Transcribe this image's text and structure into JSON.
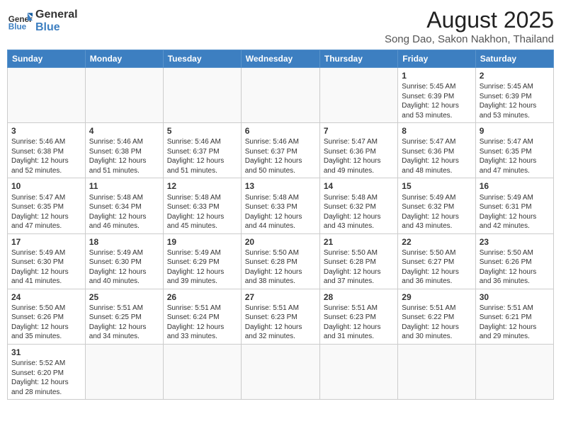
{
  "logo": {
    "text_general": "General",
    "text_blue": "Blue"
  },
  "title": "August 2025",
  "subtitle": "Song Dao, Sakon Nakhon, Thailand",
  "days_of_week": [
    "Sunday",
    "Monday",
    "Tuesday",
    "Wednesday",
    "Thursday",
    "Friday",
    "Saturday"
  ],
  "weeks": [
    [
      {
        "day": "",
        "info": ""
      },
      {
        "day": "",
        "info": ""
      },
      {
        "day": "",
        "info": ""
      },
      {
        "day": "",
        "info": ""
      },
      {
        "day": "",
        "info": ""
      },
      {
        "day": "1",
        "info": "Sunrise: 5:45 AM\nSunset: 6:39 PM\nDaylight: 12 hours\nand 53 minutes."
      },
      {
        "day": "2",
        "info": "Sunrise: 5:45 AM\nSunset: 6:39 PM\nDaylight: 12 hours\nand 53 minutes."
      }
    ],
    [
      {
        "day": "3",
        "info": "Sunrise: 5:46 AM\nSunset: 6:38 PM\nDaylight: 12 hours\nand 52 minutes."
      },
      {
        "day": "4",
        "info": "Sunrise: 5:46 AM\nSunset: 6:38 PM\nDaylight: 12 hours\nand 51 minutes."
      },
      {
        "day": "5",
        "info": "Sunrise: 5:46 AM\nSunset: 6:37 PM\nDaylight: 12 hours\nand 51 minutes."
      },
      {
        "day": "6",
        "info": "Sunrise: 5:46 AM\nSunset: 6:37 PM\nDaylight: 12 hours\nand 50 minutes."
      },
      {
        "day": "7",
        "info": "Sunrise: 5:47 AM\nSunset: 6:36 PM\nDaylight: 12 hours\nand 49 minutes."
      },
      {
        "day": "8",
        "info": "Sunrise: 5:47 AM\nSunset: 6:36 PM\nDaylight: 12 hours\nand 48 minutes."
      },
      {
        "day": "9",
        "info": "Sunrise: 5:47 AM\nSunset: 6:35 PM\nDaylight: 12 hours\nand 47 minutes."
      }
    ],
    [
      {
        "day": "10",
        "info": "Sunrise: 5:47 AM\nSunset: 6:35 PM\nDaylight: 12 hours\nand 47 minutes."
      },
      {
        "day": "11",
        "info": "Sunrise: 5:48 AM\nSunset: 6:34 PM\nDaylight: 12 hours\nand 46 minutes."
      },
      {
        "day": "12",
        "info": "Sunrise: 5:48 AM\nSunset: 6:33 PM\nDaylight: 12 hours\nand 45 minutes."
      },
      {
        "day": "13",
        "info": "Sunrise: 5:48 AM\nSunset: 6:33 PM\nDaylight: 12 hours\nand 44 minutes."
      },
      {
        "day": "14",
        "info": "Sunrise: 5:48 AM\nSunset: 6:32 PM\nDaylight: 12 hours\nand 43 minutes."
      },
      {
        "day": "15",
        "info": "Sunrise: 5:49 AM\nSunset: 6:32 PM\nDaylight: 12 hours\nand 43 minutes."
      },
      {
        "day": "16",
        "info": "Sunrise: 5:49 AM\nSunset: 6:31 PM\nDaylight: 12 hours\nand 42 minutes."
      }
    ],
    [
      {
        "day": "17",
        "info": "Sunrise: 5:49 AM\nSunset: 6:30 PM\nDaylight: 12 hours\nand 41 minutes."
      },
      {
        "day": "18",
        "info": "Sunrise: 5:49 AM\nSunset: 6:30 PM\nDaylight: 12 hours\nand 40 minutes."
      },
      {
        "day": "19",
        "info": "Sunrise: 5:49 AM\nSunset: 6:29 PM\nDaylight: 12 hours\nand 39 minutes."
      },
      {
        "day": "20",
        "info": "Sunrise: 5:50 AM\nSunset: 6:28 PM\nDaylight: 12 hours\nand 38 minutes."
      },
      {
        "day": "21",
        "info": "Sunrise: 5:50 AM\nSunset: 6:28 PM\nDaylight: 12 hours\nand 37 minutes."
      },
      {
        "day": "22",
        "info": "Sunrise: 5:50 AM\nSunset: 6:27 PM\nDaylight: 12 hours\nand 36 minutes."
      },
      {
        "day": "23",
        "info": "Sunrise: 5:50 AM\nSunset: 6:26 PM\nDaylight: 12 hours\nand 36 minutes."
      }
    ],
    [
      {
        "day": "24",
        "info": "Sunrise: 5:50 AM\nSunset: 6:26 PM\nDaylight: 12 hours\nand 35 minutes."
      },
      {
        "day": "25",
        "info": "Sunrise: 5:51 AM\nSunset: 6:25 PM\nDaylight: 12 hours\nand 34 minutes."
      },
      {
        "day": "26",
        "info": "Sunrise: 5:51 AM\nSunset: 6:24 PM\nDaylight: 12 hours\nand 33 minutes."
      },
      {
        "day": "27",
        "info": "Sunrise: 5:51 AM\nSunset: 6:23 PM\nDaylight: 12 hours\nand 32 minutes."
      },
      {
        "day": "28",
        "info": "Sunrise: 5:51 AM\nSunset: 6:23 PM\nDaylight: 12 hours\nand 31 minutes."
      },
      {
        "day": "29",
        "info": "Sunrise: 5:51 AM\nSunset: 6:22 PM\nDaylight: 12 hours\nand 30 minutes."
      },
      {
        "day": "30",
        "info": "Sunrise: 5:51 AM\nSunset: 6:21 PM\nDaylight: 12 hours\nand 29 minutes."
      }
    ],
    [
      {
        "day": "31",
        "info": "Sunrise: 5:52 AM\nSunset: 6:20 PM\nDaylight: 12 hours\nand 28 minutes."
      },
      {
        "day": "",
        "info": ""
      },
      {
        "day": "",
        "info": ""
      },
      {
        "day": "",
        "info": ""
      },
      {
        "day": "",
        "info": ""
      },
      {
        "day": "",
        "info": ""
      },
      {
        "day": "",
        "info": ""
      }
    ]
  ]
}
